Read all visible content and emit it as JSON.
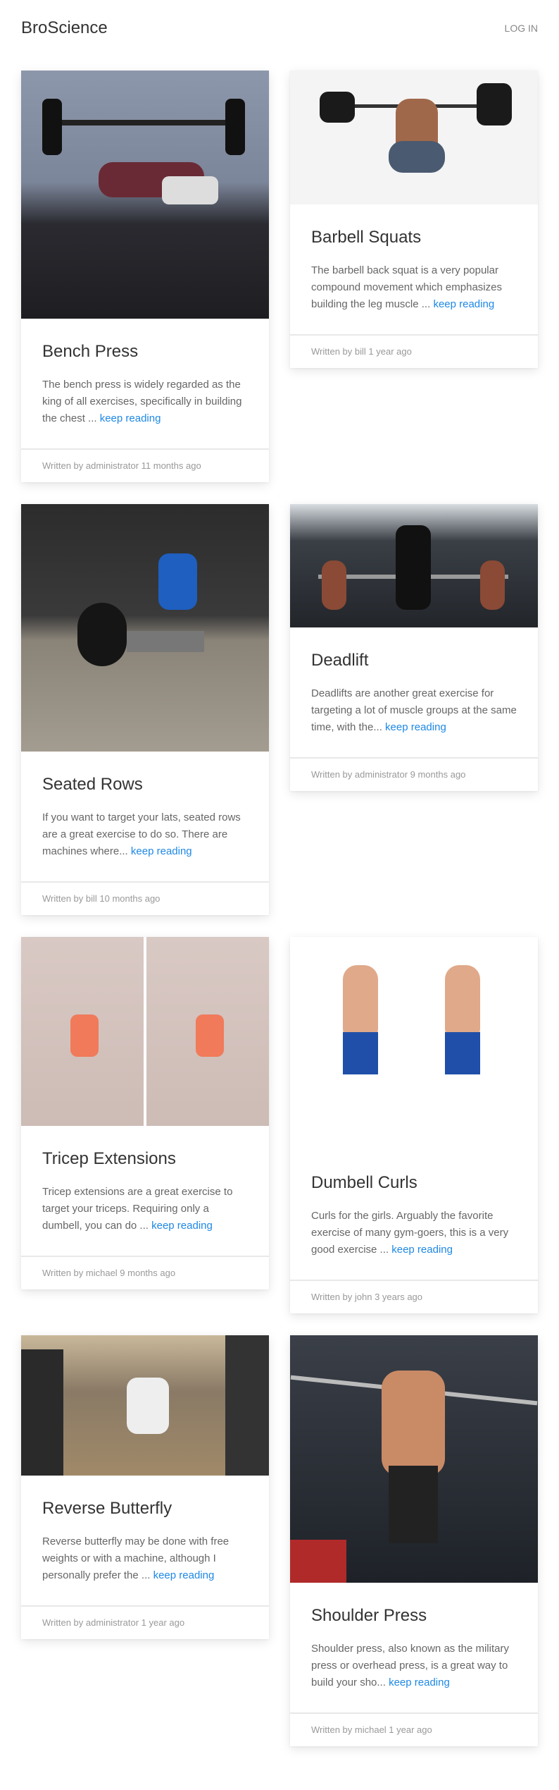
{
  "header": {
    "brand": "BroScience",
    "login_label": "LOG IN"
  },
  "link_label": "keep reading",
  "posts": [
    {
      "title": "Bench Press",
      "excerpt": "The bench press is widely regarded as the king of all exercises, specifically in building the chest ...",
      "footer": "Written by administrator 11 months ago",
      "image": "bench-press-photo"
    },
    {
      "title": "Barbell Squats",
      "excerpt": "The barbell back squat is a very popular compound movement which emphasizes building the leg muscle ...",
      "footer": "Written by bill 1 year ago",
      "image": "barbell-squat-photo"
    },
    {
      "title": "Seated Rows",
      "excerpt": "If you want to target your lats, seated rows are a great exercise to do so. There are machines where...",
      "footer": "Written by bill 10 months ago",
      "image": "seated-rows-photo"
    },
    {
      "title": "Deadlift",
      "excerpt": "Deadlifts are another great exercise for targeting a lot of muscle groups at the same time, with the...",
      "footer": "Written by administrator 9 months ago",
      "image": "deadlift-photo"
    },
    {
      "title": "Tricep Extensions",
      "excerpt": "Tricep extensions are a great exercise to target your triceps. Requiring only a dumbell, you can do ...",
      "footer": "Written by michael 9 months ago",
      "image": "tricep-extension-photo"
    },
    {
      "title": "Dumbell Curls",
      "excerpt": "Curls for the girls. Arguably the favorite exercise of many gym-goers, this is a very good exercise ...",
      "footer": "Written by john 3 years ago",
      "image": "dumbell-curls-photo"
    },
    {
      "title": "Reverse Butterfly",
      "excerpt": "Reverse butterfly may be done with free weights or with a machine, although I personally prefer the ...",
      "footer": "Written by administrator 1 year ago",
      "image": "reverse-butterfly-photo"
    },
    {
      "title": "Shoulder Press",
      "excerpt": "Shoulder press, also known as the military press or overhead press, is a great way to build your sho...",
      "footer": "Written by michael 1 year ago",
      "image": "shoulder-press-photo"
    }
  ]
}
